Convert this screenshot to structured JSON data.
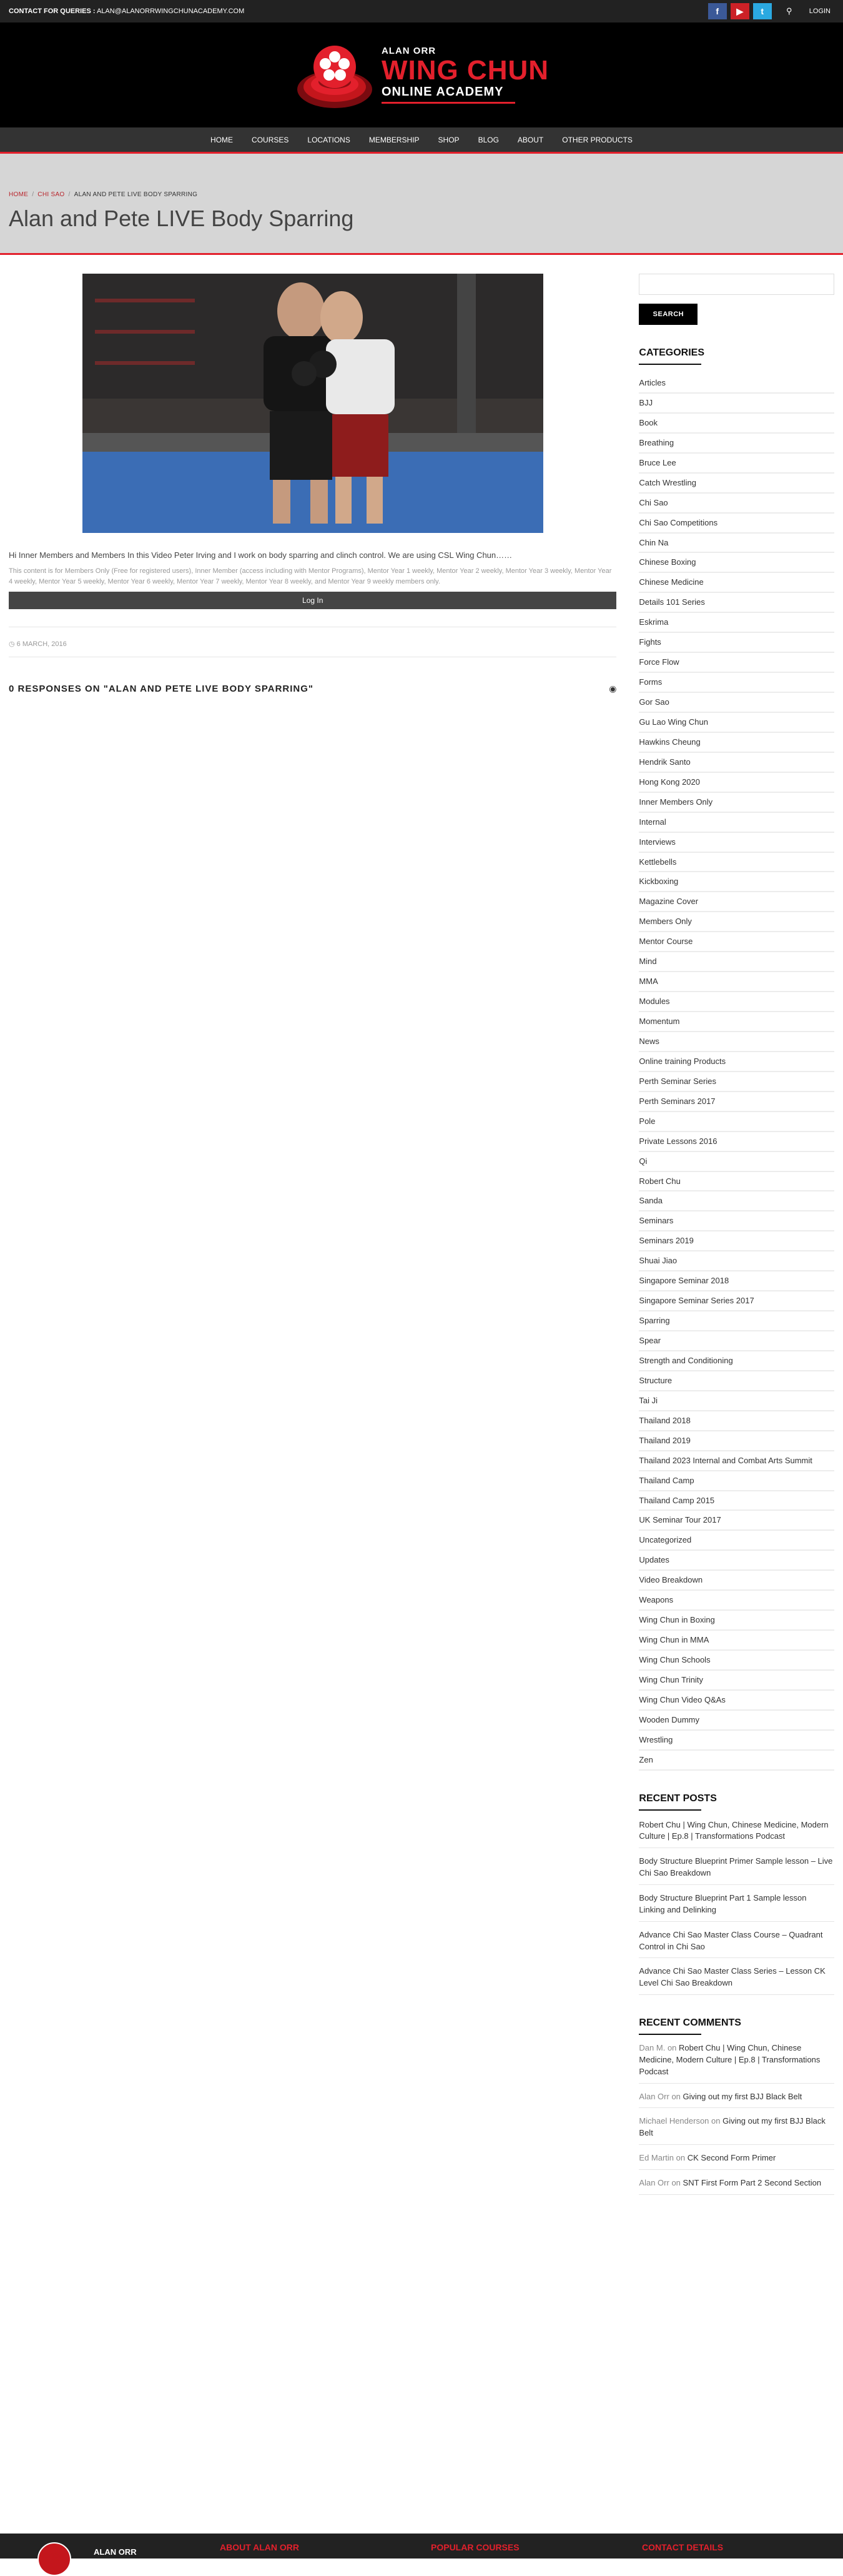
{
  "topbar": {
    "contact_label": "CONTACT FOR QUERIES :",
    "contact_email": "ALAN@ALANORRWINGCHUNACADEMY.COM",
    "facebook_glyph": "f",
    "youtube_glyph": "▶",
    "twitter_glyph": "t",
    "search_glyph": "⚲",
    "login_label": "LOGIN"
  },
  "logo": {
    "line1": "ALAN ORR",
    "line2": "WING CHUN",
    "line3": "ONLINE ACADEMY"
  },
  "nav": [
    "HOME",
    "COURSES",
    "LOCATIONS",
    "MEMBERSHIP",
    "SHOP",
    "BLOG",
    "ABOUT",
    "OTHER PRODUCTS"
  ],
  "breadcrumb": {
    "home": "HOME",
    "section": "CHI SAO",
    "current": "ALAN AND PETE LIVE BODY SPARRING"
  },
  "page_title": "Alan and Pete LIVE Body Sparring",
  "post": {
    "excerpt": "Hi Inner Members and Members In this Video Peter Irving and I work on body sparring and clinch control. We are using CSL Wing Chun……",
    "restriction": "This content is for Members Only (Free for registered users), Inner Member (access including with Mentor Programs), Mentor Year 1 weekly, Mentor Year 2 weekly, Mentor Year 3 weekly, Mentor Year 4 weekly, Mentor Year 5 weekly, Mentor Year 6 weekly, Mentor Year 7 weekly, Mentor Year 8 weekly, and Mentor Year 9 weekly members only.",
    "login_button": "Log In",
    "date": "6 MARCH, 2016",
    "responses": "0 RESPONSES ON \"ALAN AND PETE LIVE BODY SPARRING\"",
    "rss_glyph": "◉"
  },
  "sidebar": {
    "search_button": "SEARCH",
    "categories_title": "CATEGORIES",
    "categories": [
      "Articles",
      "BJJ",
      "Book",
      "Breathing",
      "Bruce Lee",
      "Catch Wrestling",
      "Chi Sao",
      "Chi Sao Competitions",
      "Chin Na",
      "Chinese Boxing",
      "Chinese Medicine",
      "Details 101 Series",
      "Eskrima",
      "Fights",
      "Force Flow",
      "Forms",
      "Gor Sao",
      "Gu Lao Wing Chun",
      "Hawkins Cheung",
      "Hendrik Santo",
      "Hong Kong 2020",
      "Inner Members Only",
      "Internal",
      "Interviews",
      "Kettlebells",
      "Kickboxing",
      "Magazine Cover",
      "Members Only",
      "Mentor Course",
      "Mind",
      "MMA",
      "Modules",
      "Momentum",
      "News",
      "Online training Products",
      "Perth Seminar Series",
      "Perth Seminars 2017",
      "Pole",
      "Private Lessons 2016",
      "Qi",
      "Robert Chu",
      "Sanda",
      "Seminars",
      "Seminars 2019",
      "Shuai Jiao",
      "Singapore Seminar 2018",
      "Singapore Seminar Series 2017",
      "Sparring",
      "Spear",
      "Strength and Conditioning",
      "Structure",
      "Tai Ji",
      "Thailand 2018",
      "Thailand 2019",
      "Thailand 2023 Internal and Combat Arts Summit",
      "Thailand Camp",
      "Thailand Camp 2015",
      "UK Seminar Tour 2017",
      "Uncategorized",
      "Updates",
      "Video Breakdown",
      "Weapons",
      "Wing Chun in Boxing",
      "Wing Chun in MMA",
      "Wing Chun Schools",
      "Wing Chun Trinity",
      "Wing Chun Video Q&As",
      "Wooden Dummy",
      "Wrestling",
      "Zen"
    ],
    "recent_posts_title": "RECENT POSTS",
    "recent_posts": [
      "Robert Chu | Wing Chun, Chinese Medicine, Modern Culture | Ep.8 | Transformations Podcast",
      "Body Structure Blueprint Primer Sample lesson – Live Chi Sao Breakdown",
      "Body Structure Blueprint Part 1 Sample lesson Linking and Delinking",
      "Advance Chi Sao Master Class Course – Quadrant Control in Chi Sao",
      "Advance Chi Sao Master Class Series – Lesson CK Level Chi Sao Breakdown"
    ],
    "recent_comments_title": "RECENT COMMENTS",
    "recent_comments": [
      {
        "author": "Dan M.",
        "on": "on",
        "post": "Robert Chu | Wing Chun, Chinese Medicine, Modern Culture | Ep.8 | Transformations Podcast"
      },
      {
        "author": "Alan Orr",
        "on": "on",
        "post": "Giving out my first BJJ Black Belt"
      },
      {
        "author": "Michael Henderson",
        "on": "on",
        "post": "Giving out my first BJJ Black Belt"
      },
      {
        "author": "Ed Martin",
        "on": "on",
        "post": "CK Second Form Primer"
      },
      {
        "author": "Alan Orr",
        "on": "on",
        "post": "SNT First Form Part 2 Second Section"
      }
    ]
  },
  "footer": {
    "name": "ALAN ORR",
    "about": "ABOUT ALAN ORR",
    "popular": "POPULAR COURSES",
    "contact": "CONTACT DETAILS"
  }
}
